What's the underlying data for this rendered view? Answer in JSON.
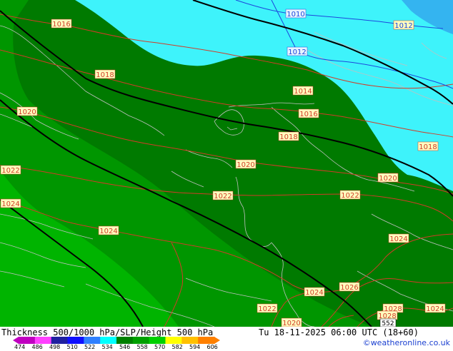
{
  "footer": {
    "title": "Thickness 500/1000 hPa/SLP/Height 500 hPa",
    "valid": "Tu 18-11-2025 06:00 UTC (18+60)",
    "credit": "©weatheronline.co.uk"
  },
  "legend": {
    "ticks": [
      "474",
      "486",
      "498",
      "510",
      "522",
      "534",
      "546",
      "558",
      "570",
      "582",
      "594",
      "606"
    ],
    "colors": [
      "#c000c0",
      "#ff40ff",
      "#2020a0",
      "#1010ff",
      "#3080ff",
      "#00ffff",
      "#008000",
      "#00a000",
      "#00d000",
      "#ffff00",
      "#ffc000",
      "#ff8000"
    ]
  },
  "colors": {
    "light_cyan": "#3ef3fb",
    "blue_corner": "#34b4f0",
    "light_green": "#00b400",
    "mid_green": "#009600",
    "dark_green": "#007a00",
    "isobar": "#d23c28",
    "thickness": "#000000",
    "border": "#c0c0c0"
  },
  "isobar_labels": [
    "1016",
    "1018",
    "1020",
    "1022",
    "1024",
    "1020",
    "1022",
    "1014",
    "1016",
    "1018",
    "1020",
    "1022",
    "1020",
    "1018",
    "1024",
    "1024",
    "1026",
    "1022",
    "1020",
    "1028",
    "1028",
    "1024",
    "1012"
  ],
  "blue_labels": [
    "1010",
    "1012",
    "1012"
  ],
  "height_label": "552"
}
